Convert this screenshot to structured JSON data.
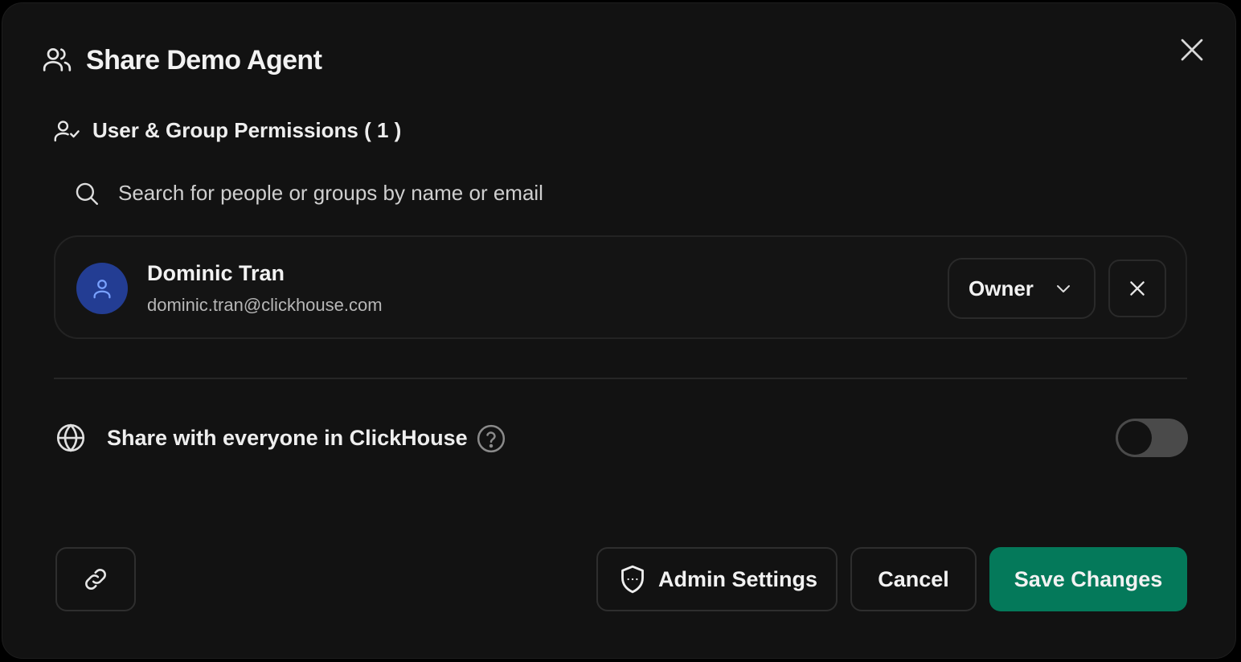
{
  "modal": {
    "title": "Share Demo Agent"
  },
  "permissions": {
    "section_title": "User & Group Permissions ( 1 )",
    "search_placeholder": "Search for people or groups by name or email",
    "users": [
      {
        "name": "Dominic Tran",
        "email": "dominic.tran@clickhouse.com",
        "role": "Owner"
      }
    ]
  },
  "share": {
    "label": "Share with everyone in ClickHouse",
    "enabled": false
  },
  "footer": {
    "admin_label": "Admin Settings",
    "cancel_label": "Cancel",
    "save_label": "Save Changes"
  },
  "colors": {
    "background": "#121212",
    "avatar": "#233d93",
    "primary": "#04795a",
    "toggle_off": "#4a4a4a"
  },
  "icons": {
    "title": "users-icon",
    "section": "user-check-icon",
    "search": "search-icon",
    "avatar": "user-icon",
    "dropdown": "chevron-down-icon",
    "remove": "close-icon",
    "share": "globe-icon",
    "help": "help-circle-icon",
    "link": "link-icon",
    "admin": "shield-icon"
  }
}
